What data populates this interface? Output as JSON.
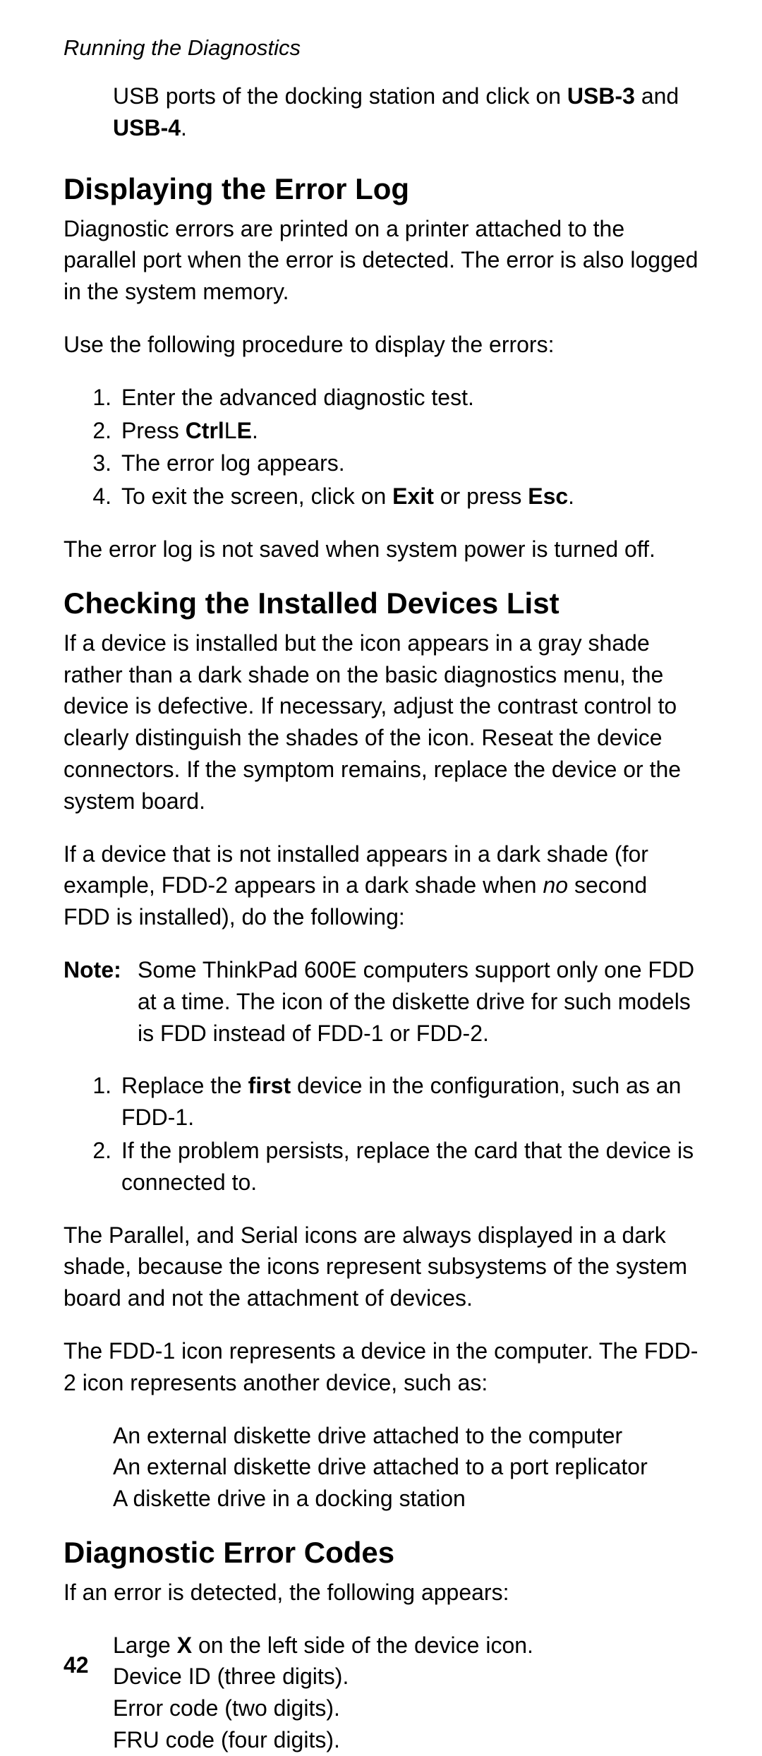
{
  "header": "Running the Diagnostics",
  "intro_cont_p1": "USB ports of the docking station and click on ",
  "intro_cont_b1": "USB-3",
  "intro_cont_p2": " and ",
  "intro_cont_b2": "USB-4",
  "intro_cont_p3": ".",
  "h_error_log": "Displaying the Error Log",
  "p_error_intro": "Diagnostic errors are printed on a printer attached to the parallel port when the error is detected.  The error is also logged in the system memory.",
  "p_use_following": "Use the following procedure to display the errors:",
  "steps1": {
    "n1": "1.",
    "t1": "Enter the advanced diagnostic test.",
    "n2": "2.",
    "t2a": "Press ",
    "t2b": "Ctrl",
    "t2c": "L",
    "t2d": "E",
    "t2e": ".",
    "n3": "3.",
    "t3": "The error log appears.",
    "n4": "4.",
    "t4a": "To exit the screen, click on ",
    "t4b": "Exit",
    "t4c": " or press ",
    "t4d": "Esc",
    "t4e": "."
  },
  "p_notsaved": "The error log is not saved when system power is turned off.",
  "h_check": "Checking the Installed Devices List",
  "p_check1": "If a device is installed but the icon appears in a gray shade rather than a dark shade on the basic diagnostics menu, the device is defective.  If necessary, adjust the contrast control to clearly distinguish the shades of the icon. Reseat the device connectors.  If the symptom remains, replace the device or the system board.",
  "p_check2a": "If a device that is not installed appears in a dark shade (for example, FDD-2 appears in a dark shade when ",
  "p_check2i": "no",
  "p_check2b": " second FDD is installed), do the following:",
  "note_label": "Note:",
  "note_text": "Some ThinkPad 600E computers support only one FDD at a time.  The icon of the diskette drive for such models is FDD instead of FDD-1 or FDD-2.",
  "steps2": {
    "n1": "1.",
    "t1a": "Replace the ",
    "t1b": "first",
    "t1c": " device in the configuration, such as an FDD-1.",
    "n2": "2.",
    "t2": "If the problem persists, replace the card that the device is connected to."
  },
  "p_parallel": "The Parallel, and Serial icons are always displayed in a dark shade, because the icons represent subsystems of the system board and not the attachment of devices.",
  "p_fdd": "The FDD-1 icon represents a device in the computer.  The FDD-2 icon represents another device, such as:",
  "bullets_fdd": {
    "b1": "An external diskette drive attached to the computer",
    "b2": "An external diskette drive attached to a port replicator",
    "b3": "A diskette drive in a docking station"
  },
  "h_codes": "Diagnostic Error Codes",
  "p_codes": "If an error is detected, the following appears:",
  "bullets_codes": {
    "b1a": "Large ",
    "b1b": "X",
    "b1c": " on the left side of the device icon.",
    "b2": "Device ID (three digits).",
    "b3": "Error code (two digits).",
    "b4": "FRU code (four digits)."
  },
  "page_number": "42"
}
